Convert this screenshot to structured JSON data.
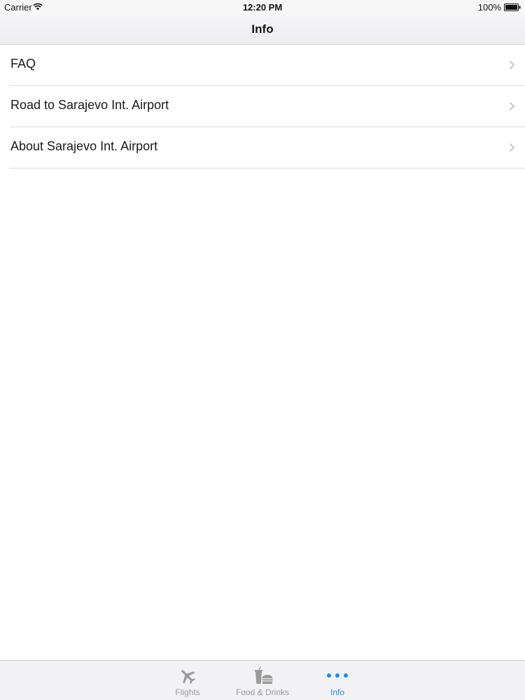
{
  "status_bar": {
    "carrier": "Carrier",
    "time": "12:20 PM",
    "battery": "100%"
  },
  "nav_bar": {
    "title": "Info"
  },
  "list": {
    "items": [
      {
        "label": "FAQ"
      },
      {
        "label": "Road to Sarajevo Int. Airport"
      },
      {
        "label": "About Sarajevo Int. Airport"
      }
    ]
  },
  "tab_bar": {
    "tabs": [
      {
        "label": "Flights",
        "icon": "airplane-icon",
        "active": false
      },
      {
        "label": "Food & Drinks",
        "icon": "food-drinks-icon",
        "active": false
      },
      {
        "label": "Info",
        "icon": "more-dots-icon",
        "active": true
      }
    ]
  },
  "colors": {
    "accent": "#1a8cf0",
    "inactive_tab": "#9a9a9a",
    "separator": "#dcdcdf",
    "chevron": "#c7c7cc"
  }
}
